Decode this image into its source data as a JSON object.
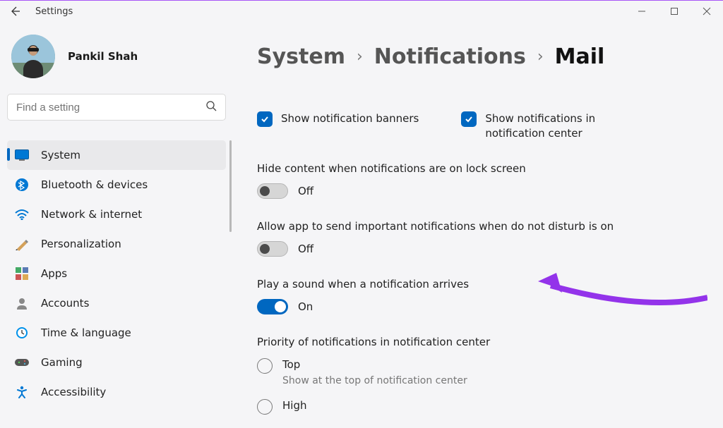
{
  "window": {
    "title": "Settings"
  },
  "user": {
    "name": "Pankil Shah"
  },
  "search": {
    "placeholder": "Find a setting"
  },
  "sidebar": {
    "items": [
      {
        "label": "System"
      },
      {
        "label": "Bluetooth & devices"
      },
      {
        "label": "Network & internet"
      },
      {
        "label": "Personalization"
      },
      {
        "label": "Apps"
      },
      {
        "label": "Accounts"
      },
      {
        "label": "Time & language"
      },
      {
        "label": "Gaming"
      },
      {
        "label": "Accessibility"
      }
    ]
  },
  "breadcrumb": {
    "level1": "System",
    "level2": "Notifications",
    "current": "Mail"
  },
  "checkboxes": {
    "banners": "Show notification banners",
    "center": "Show notifications in notification center"
  },
  "settings": {
    "hide_content": {
      "title": "Hide content when notifications are on lock screen",
      "state": "Off"
    },
    "important": {
      "title": "Allow app to send important notifications when do not disturb is on",
      "state": "Off"
    },
    "sound": {
      "title": "Play a sound when a notification arrives",
      "state": "On"
    },
    "priority": {
      "title": "Priority of notifications in notification center",
      "options": {
        "top": {
          "label": "Top",
          "sub": "Show at the top of notification center"
        },
        "high": {
          "label": "High"
        }
      }
    }
  }
}
